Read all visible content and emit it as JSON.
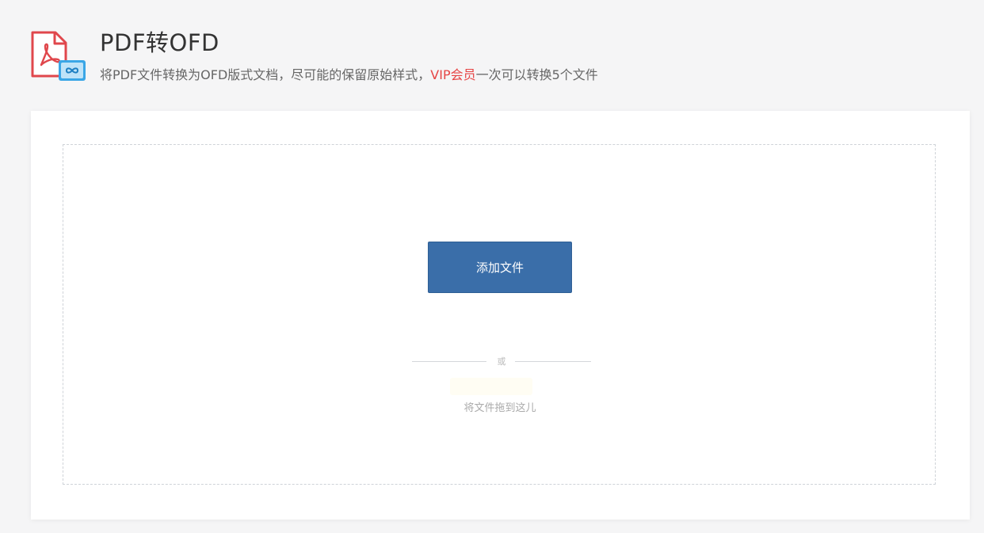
{
  "header": {
    "title": "PDF转OFD",
    "subtitle_prefix": "将PDF文件转换为OFD版式文档，尽可能的保留原始样式，",
    "subtitle_vip": "VIP会员",
    "subtitle_suffix": "一次可以转换5个文件",
    "icon": "pdf-to-ofd-icon"
  },
  "dropzone": {
    "add_button_label": "添加文件",
    "or_text": "或",
    "drag_hint": "将文件拖到这儿"
  },
  "colors": {
    "accent": "#3a6ea9",
    "vip": "#e64545",
    "pdf_red": "#e0474c",
    "ofd_blue": "#3aa6e6"
  }
}
